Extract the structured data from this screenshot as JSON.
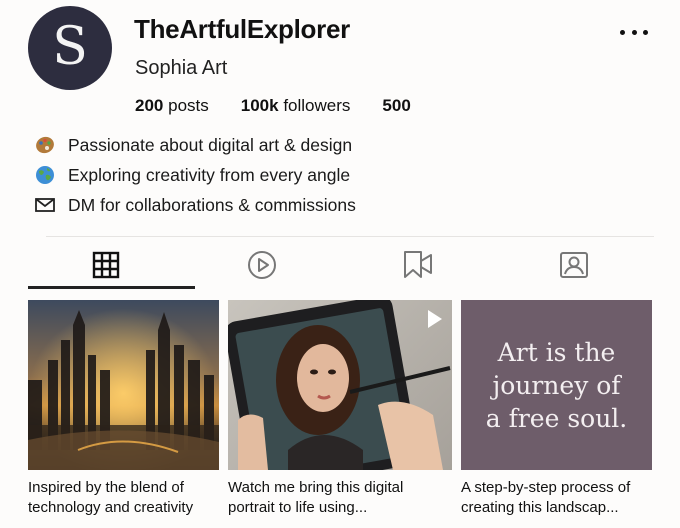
{
  "profile": {
    "avatar_letter": "S",
    "username": "TheArtfulExplorer",
    "display_name": "Sophia Art",
    "stats": {
      "posts_count": "200",
      "posts_label": "posts",
      "followers_count": "100k",
      "followers_label": "followers",
      "following_count": "500"
    },
    "bio": [
      {
        "icon": "palette-icon",
        "text": "Passionate about digital art & design"
      },
      {
        "icon": "globe-icon",
        "text": "Exploring creativity from every angle"
      },
      {
        "icon": "envelope-icon",
        "text": "DM for collaborations & commissions"
      }
    ]
  },
  "tabs": [
    {
      "name": "grid",
      "icon": "grid-icon",
      "active": true
    },
    {
      "name": "reels",
      "icon": "play-icon",
      "active": false
    },
    {
      "name": "saved",
      "icon": "bookmark-video-icon",
      "active": false
    },
    {
      "name": "tagged",
      "icon": "tagged-person-icon",
      "active": false
    }
  ],
  "posts": [
    {
      "caption": "Inspired by the blend of technology and creativity",
      "thumb": "futuristic-city-art"
    },
    {
      "caption": "Watch me bring this digital portrait to life using...",
      "thumb": "tablet-portrait-drawing",
      "is_video": true
    },
    {
      "caption": "A step-by-step process of creating this landscap...",
      "thumb": "quote-card",
      "quote_text": "Art is the journey of a free soul."
    }
  ],
  "colors": {
    "avatar_bg": "#2d2d3f",
    "quote_bg": "#6e5d6a",
    "active_tab_underline": "#222222"
  }
}
